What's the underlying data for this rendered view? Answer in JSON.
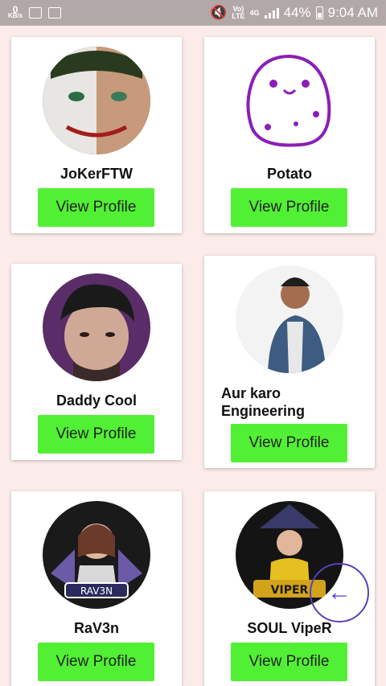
{
  "status": {
    "data_rate_value": "0",
    "data_rate_unit": "KB/s",
    "volte": "Vo)",
    "lte": "LTE",
    "network": "4G",
    "battery": "44%",
    "time": "9:04 AM"
  },
  "profiles": [
    {
      "name": "JoKerFTW",
      "button": "View Profile",
      "avatar": "joker-avatar"
    },
    {
      "name": "Potato",
      "button": "View Profile",
      "avatar": "potato-avatar"
    },
    {
      "name": "Daddy Cool",
      "button": "View Profile",
      "avatar": "cartoon-man-avatar"
    },
    {
      "name": "Aur karo\nEngineering",
      "button": "View Profile",
      "avatar": "man-denim-jacket-avatar"
    },
    {
      "name": "RaV3n",
      "button": "View Profile",
      "avatar": "rav3n-gamer-avatar"
    },
    {
      "name": "SOUL VipeR",
      "button": "View Profile",
      "avatar": "viper-gamer-avatar"
    }
  ],
  "back_icon": "arrow-left-icon",
  "colors": {
    "button": "#52f034",
    "background": "#fbeceb",
    "statusbar": "#b3a8a8",
    "fab_ring": "#5b3fb8"
  }
}
